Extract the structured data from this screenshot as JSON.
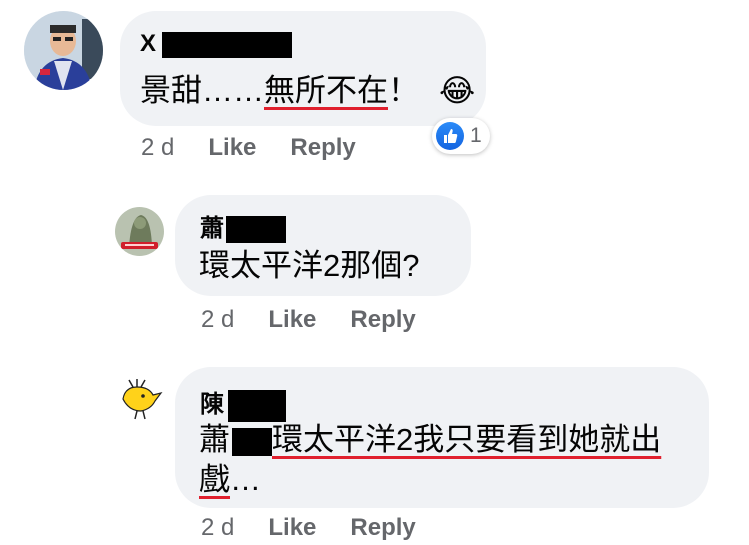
{
  "comments": [
    {
      "author_prefix": "X",
      "text_plain": "景甜……",
      "text_underlined": "無所不在",
      "text_suffix": "！",
      "emoji": "😂",
      "time": "2 d",
      "like_label": "Like",
      "reply_label": "Reply",
      "reaction_count": "1"
    },
    {
      "author_prefix": "蕭",
      "text": "環太平洋2那個?",
      "time": "2 d",
      "like_label": "Like",
      "reply_label": "Reply"
    },
    {
      "author_prefix": "陳",
      "mention_prefix": "蕭",
      "text_line1": "環太平洋2我只要看到她就出",
      "text_line2_underlined": "戲",
      "text_line2_suffix": "…",
      "time": "2 d",
      "like_label": "Like",
      "reply_label": "Reply"
    }
  ],
  "colors": {
    "bubble": "#f0f2f5",
    "underline": "#e0202e",
    "meta": "#65676b",
    "like_blue": "#1877f2"
  }
}
